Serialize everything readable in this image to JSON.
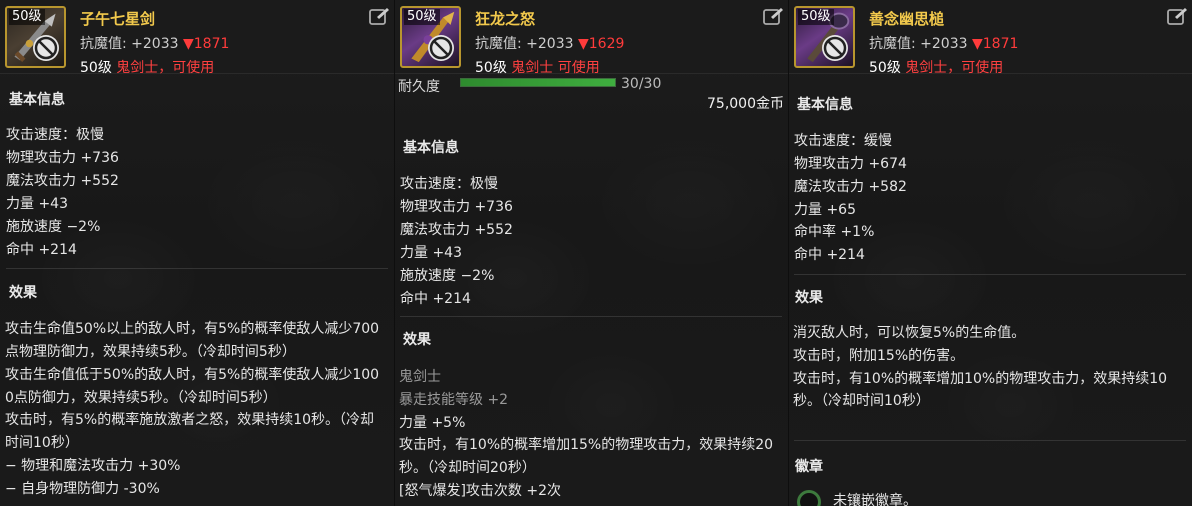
{
  "panels": [
    {
      "level_tag": "50级",
      "name": "子午七星剑",
      "resist_label": "抗魔值:",
      "resist_value": "+2033",
      "resist_diff": "▼1871",
      "req_level": "50级",
      "req_class": "鬼剑士，可使用",
      "icons": {
        "item": "sword-item-icon",
        "unusable": "prohibited-icon",
        "action": "edit-share-icon"
      },
      "basic_title": "基本信息",
      "stats": [
        "攻击速度：极慢",
        "物理攻击力 +736",
        "魔法攻击力 +552",
        "力量 +43",
        "施放速度 −2%",
        "命中 +214"
      ],
      "effect_title": "效果",
      "effects": [
        "攻击生命值50%以上的敌人时，有5%的概率使敌人减少700",
        "点物理防御力，效果持续5秒。（冷却时间5秒）",
        "攻击生命值低于50%的敌人时，有5%的概率使敌人减少100",
        "0点防御力，效果持续5秒。（冷却时间5秒）",
        "攻击时，有5%的概率施放激者之怒，效果持续10秒。（冷却",
        "时间10秒）",
        " − 物理和魔法攻击力 +30%",
        " − 自身物理防御力 -30%"
      ]
    },
    {
      "level_tag": "50级",
      "name": "狂龙之怒",
      "resist_label": "抗魔值:",
      "resist_value": "+2033",
      "resist_diff": "▼1629",
      "req_level": "50级",
      "req_class": "鬼剑士 可使用",
      "icons": {
        "item": "dragon-blade-item-icon",
        "unusable": "prohibited-icon",
        "action": "edit-share-icon"
      },
      "durability_label": "耐久度",
      "durability_value": "30/30",
      "durability_fraction": 1.0,
      "price": "75,000金币",
      "basic_title": "基本信息",
      "stats": [
        "攻击速度：极慢",
        "物理攻击力 +736",
        "魔法攻击力 +552",
        "力量 +43",
        "施放速度 −2%",
        "命中 +214"
      ],
      "effect_title": "效果",
      "effects_gray": [
        "鬼剑士",
        "暴走技能等级 +2"
      ],
      "effects": [
        "力量 +5%",
        "攻击时，有10%的概率增加15%的物理攻击力，效果持续20",
        "秒。（冷却时间20秒）",
        "[怒气爆发]攻击次数 +2次"
      ]
    },
    {
      "level_tag": "50级",
      "name": "善念幽思槌",
      "resist_label": "抗魔值:",
      "resist_value": "+2033",
      "resist_diff": "▼1871",
      "req_level": "50级",
      "req_class": "鬼剑士，可使用",
      "icons": {
        "item": "club-item-icon",
        "unusable": "prohibited-icon",
        "action": "edit-share-icon",
        "badge": "badge-slot-icon"
      },
      "basic_title": "基本信息",
      "stats": [
        "攻击速度：缓慢",
        "物理攻击力 +674",
        "魔法攻击力 +582",
        "力量 +65",
        "命中率 +1%",
        "命中 +214"
      ],
      "effect_title": "效果",
      "effects": [
        "消灭敌人时，可以恢复5%的生命值。",
        "攻击时，附加15%的伤害。",
        "攻击时，有10%的概率增加10%的物理攻击力，效果持续10",
        "秒。（冷却时间10秒）"
      ],
      "badge_title": "徽章",
      "badge_text": "未镶嵌徽章。"
    }
  ]
}
